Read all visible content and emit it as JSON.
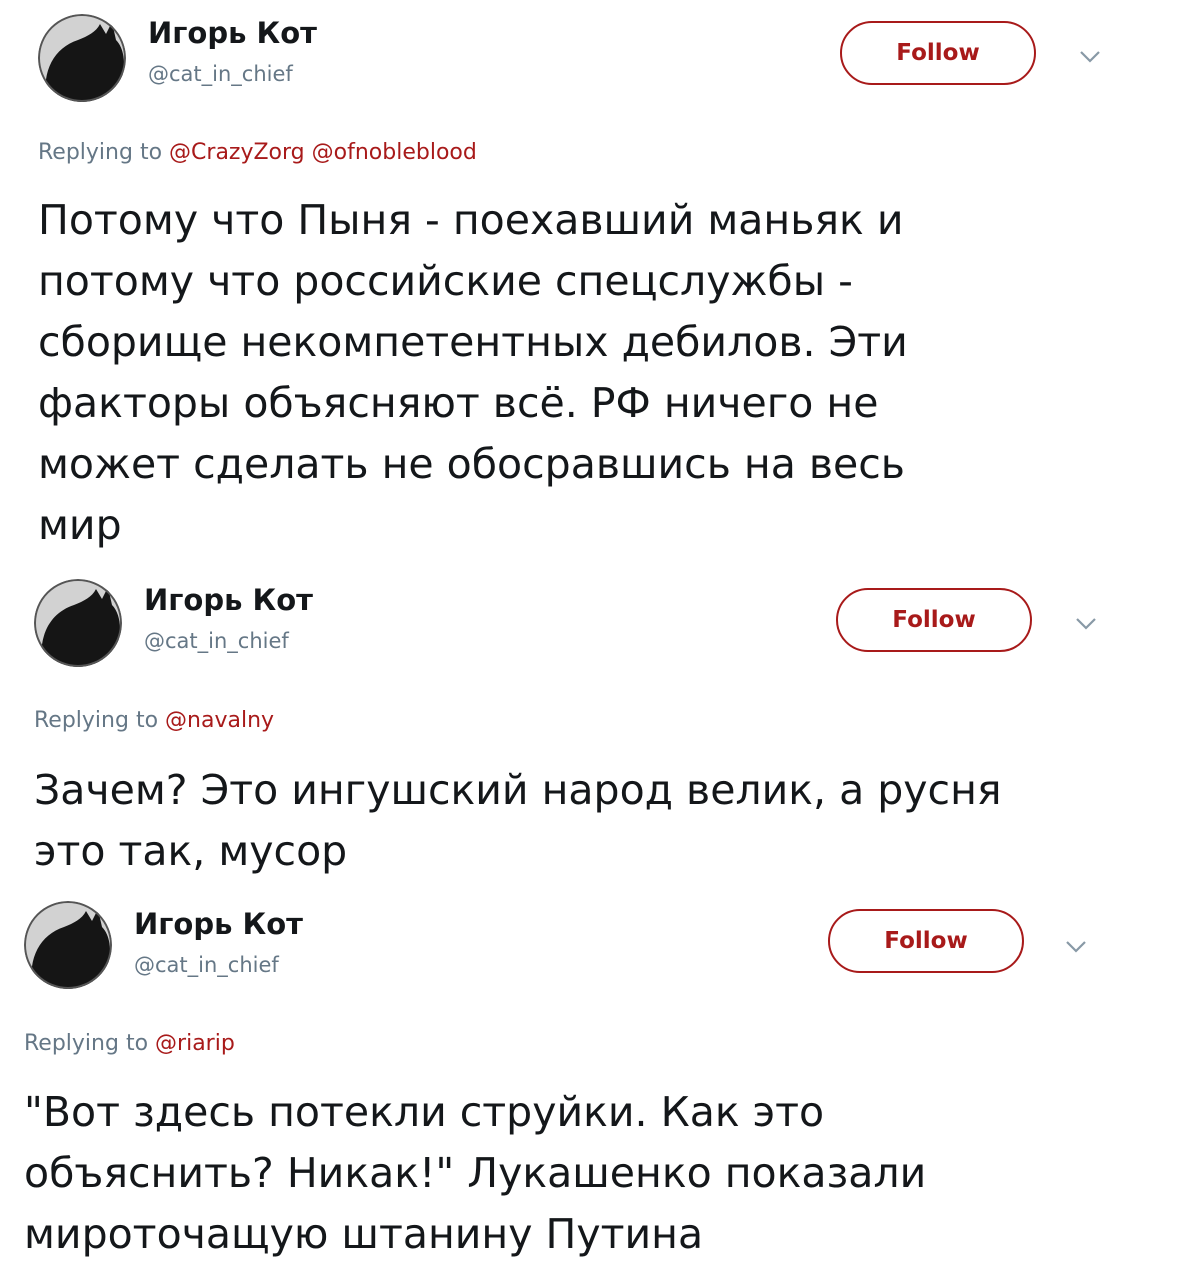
{
  "colors": {
    "accent": "#a81a1a",
    "secondary_text": "#657786",
    "primary_text": "#14171a"
  },
  "tweets": [
    {
      "author_name": "Игорь Кот",
      "author_handle": "@cat_in_chief",
      "avatar_icon": "black-cat-silhouette-icon",
      "follow_label": "Follow",
      "reply_prefix": "Replying to",
      "reply_to": [
        "@CrazyZorg",
        "@ofnobleblood"
      ],
      "text": "Потому что Пыня - поехавший маньяк и\nпотому что российские спецслужбы -\nсборище некомпетентных дебилов. Эти\nфакторы объясняют всё. РФ ничего не\nможет сделать не обосравшись на весь\nмир"
    },
    {
      "author_name": "Игорь Кот",
      "author_handle": "@cat_in_chief",
      "avatar_icon": "black-cat-silhouette-icon",
      "follow_label": "Follow",
      "reply_prefix": "Replying to",
      "reply_to": [
        "@navalny"
      ],
      "text": "Зачем? Это ингушский народ велик, а русня\nэто так, мусор"
    },
    {
      "author_name": "Игорь Кот",
      "author_handle": "@cat_in_chief",
      "avatar_icon": "black-cat-silhouette-icon",
      "follow_label": "Follow",
      "reply_prefix": "Replying to",
      "reply_to": [
        "@riarip"
      ],
      "text": "\"Вот здесь потекли струйки. Как это\nобъяснить? Никак!\" Лукашенко показали\nмироточащую штанину Путина"
    }
  ]
}
